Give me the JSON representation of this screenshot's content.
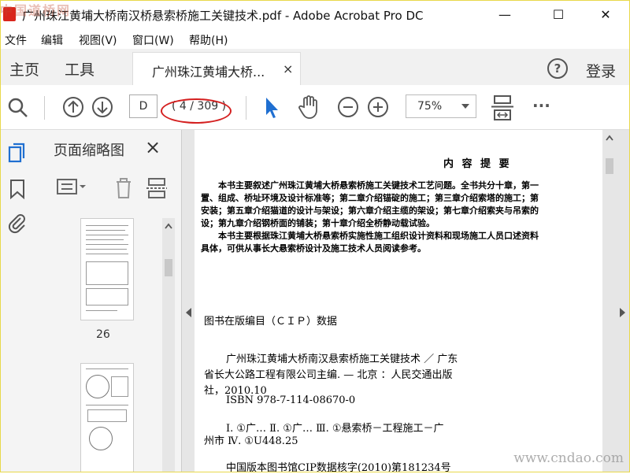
{
  "window": {
    "title": "广州珠江黄埔大桥南汉桥悬索桥施工关键技术.pdf - Adobe Acrobat Pro DC",
    "watermark_top": "中国道桥网",
    "min_glyph": "—",
    "max_glyph": "☐",
    "close_glyph": "✕"
  },
  "menu": {
    "items": [
      "文件",
      "编辑",
      "视图(V)",
      "窗口(W)",
      "帮助(H)"
    ]
  },
  "tabs": {
    "home": "主页",
    "tools": "工具",
    "document": "广州珠江黄埔大桥...",
    "document_close": "×",
    "help": "?",
    "login": "登录"
  },
  "toolbar": {
    "page_input": "D",
    "page_count": "( 4 / 309 )",
    "zoom": "75%",
    "more": "···"
  },
  "thumbnails": {
    "title": "页面缩略图",
    "close": "×",
    "pages": [
      {
        "label": "26"
      },
      {
        "label": ""
      }
    ]
  },
  "document": {
    "heading": "内 容 提 要",
    "summary_lines": [
      "　　本书主要叙述广州珠江黄埔大桥悬索桥施工关键技术工艺问题。全书共分十章，第一",
      "置、组成、桥址环境及设计标准等；第二章介绍锚碇的施工；第三章介绍索塔的施工；第",
      "安装；第五章介绍猫道的设计与架设；第六章介绍主缆的架设；第七章介绍索夹与吊索的",
      "设；第九章介绍钢桥面的铺装；第十章介绍全桥静动载试验。",
      "　　本书主要根据珠江黄埔大桥悬索桥实施性施工组织设计资料和现场施工人员口述资料",
      "具体，可供从事长大悬索桥设计及施工技术人员阅读参考。"
    ],
    "cip_heading": "图书在版编目（ＣＩＰ）数据",
    "cip_lines": [
      "广州珠江黄埔大桥南汉悬索桥施工关键技术 ／ 广东",
      "省长大公路工程有限公司主编. — 北京 ：人民交通出版",
      "社，2010.10",
      "ISBN  978-7-114-08670-0"
    ],
    "cip_class_lines": [
      "Ⅰ. ①广…  Ⅱ. ①广…  Ⅲ. ①悬索桥－工程施工－广",
      "州市  Ⅳ. ①U448.25"
    ],
    "cip_number": "中国版本图书馆CIP数据核字(2010)第181234号",
    "watermark": "www.cndao.com"
  }
}
